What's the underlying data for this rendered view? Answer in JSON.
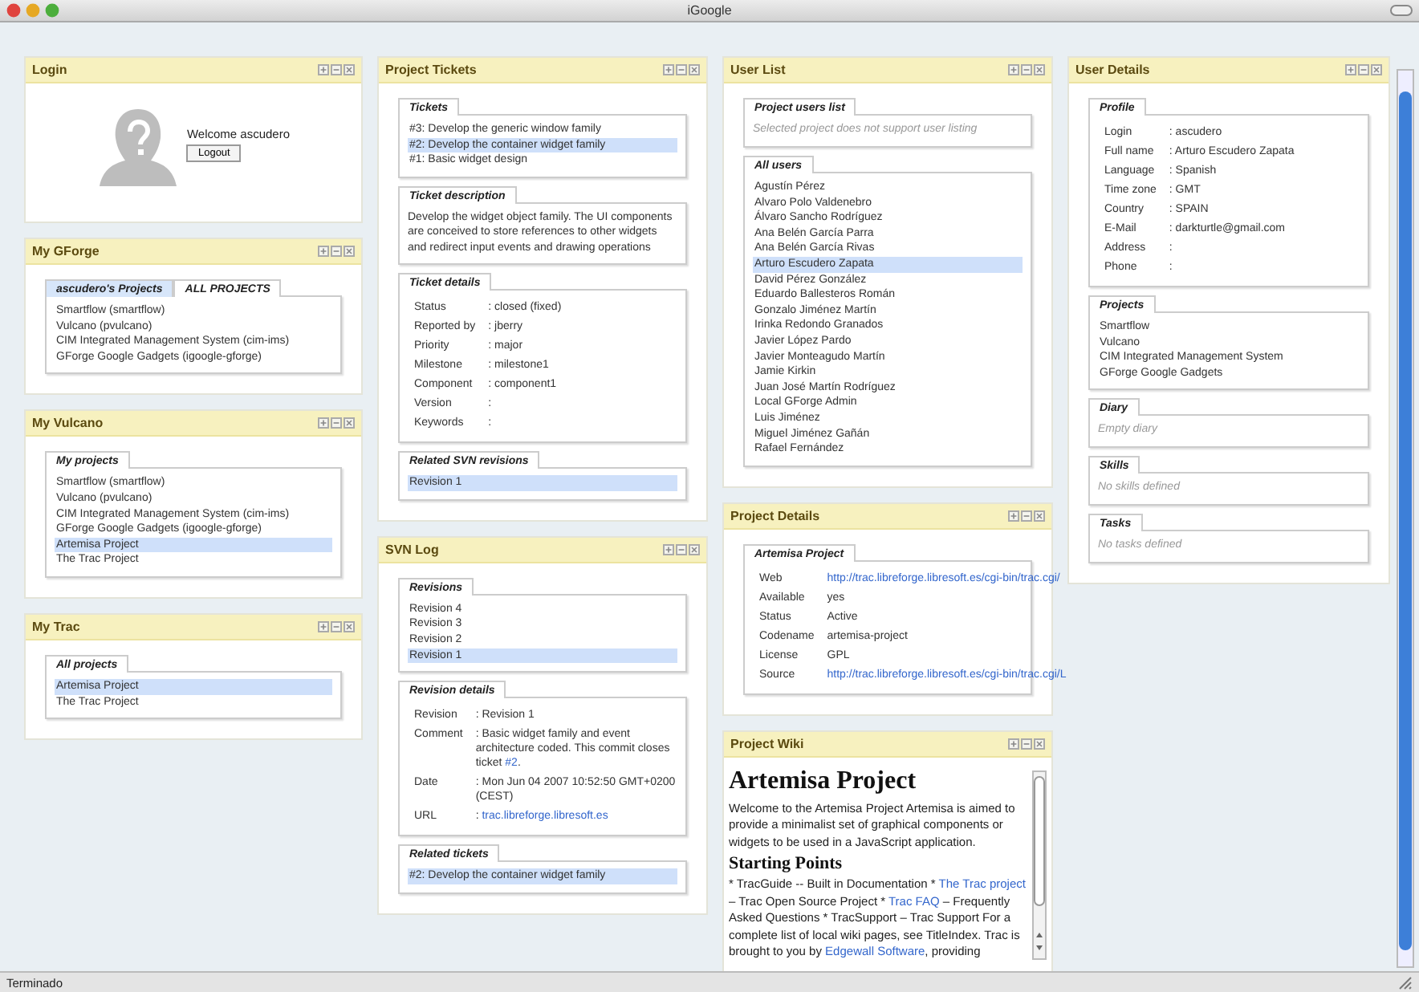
{
  "window": {
    "title": "iGoogle"
  },
  "columns": [
    {
      "gadgets": [
        {
          "title": "Login",
          "sections": [
            {
              "kind": "login",
              "message": "Welcome ascudero",
              "button": "Logout"
            }
          ]
        },
        {
          "title": "My GForge",
          "sections": [
            {
              "kind": "list",
              "tabs": [
                {
                  "label": "ascudero's Projects",
                  "selected": true
                },
                {
                  "label": "ALL PROJECTS",
                  "selected": false
                }
              ],
              "items": [
                {
                  "text": "Smartflow (smartflow)",
                  "selected": false
                },
                {
                  "text": "Vulcano (pvulcano)",
                  "selected": false
                },
                {
                  "text": "CIM Integrated Management System (cim-ims)",
                  "selected": false
                },
                {
                  "text": "GForge Google Gadgets (igoogle-gforge)",
                  "selected": false
                }
              ]
            }
          ]
        },
        {
          "title": "My Vulcano",
          "sections": [
            {
              "kind": "list",
              "label": "My projects",
              "items": [
                {
                  "text": "Smartflow (smartflow)",
                  "selected": false
                },
                {
                  "text": "Vulcano (pvulcano)",
                  "selected": false
                },
                {
                  "text": "CIM Integrated Management System (cim-ims)",
                  "selected": false
                },
                {
                  "text": "GForge Google Gadgets (igoogle-gforge)",
                  "selected": false
                },
                {
                  "text": "Artemisa Project",
                  "selected": true
                },
                {
                  "text": "The Trac Project",
                  "selected": false
                }
              ]
            }
          ]
        },
        {
          "title": "My Trac",
          "sections": [
            {
              "kind": "list",
              "label": "All projects",
              "items": [
                {
                  "text": "Artemisa Project",
                  "selected": true
                },
                {
                  "text": "The Trac Project",
                  "selected": false
                }
              ]
            }
          ]
        }
      ]
    },
    {
      "gadgets": [
        {
          "title": "Project Tickets",
          "sections": [
            {
              "kind": "list",
              "label": "Tickets",
              "items": [
                {
                  "text": "#3: Develop the generic window family",
                  "selected": false
                },
                {
                  "text": "#2: Develop the container widget family",
                  "selected": true
                },
                {
                  "text": "#1: Basic widget design",
                  "selected": false
                }
              ]
            },
            {
              "kind": "text",
              "label": "Ticket description",
              "text": "Develop the widget object family. The UI components are conceived to store references to other widgets and redirect input events and drawing operations"
            },
            {
              "kind": "fields",
              "label": "Ticket details",
              "rows": [
                {
                  "label": "Status",
                  "parts": [
                    {
                      "text": ": closed (fixed)",
                      "link": false
                    }
                  ]
                },
                {
                  "label": "Reported by",
                  "parts": [
                    {
                      "text": ": jberry",
                      "link": false
                    }
                  ]
                },
                {
                  "label": "Priority",
                  "parts": [
                    {
                      "text": ": major",
                      "link": false
                    }
                  ]
                },
                {
                  "label": "Milestone",
                  "parts": [
                    {
                      "text": ": milestone1",
                      "link": false
                    }
                  ]
                },
                {
                  "label": "Component",
                  "parts": [
                    {
                      "text": ": component1",
                      "link": false
                    }
                  ]
                },
                {
                  "label": "Version",
                  "parts": [
                    {
                      "text": ":",
                      "link": false
                    }
                  ]
                },
                {
                  "label": "Keywords",
                  "parts": [
                    {
                      "text": ":",
                      "link": false
                    }
                  ]
                }
              ]
            },
            {
              "kind": "list",
              "label": "Related SVN revisions",
              "items": [
                {
                  "text": "Revision 1",
                  "selected": true
                }
              ]
            }
          ]
        },
        {
          "title": "SVN Log",
          "sections": [
            {
              "kind": "list",
              "label": "Revisions",
              "items": [
                {
                  "text": "Revision 4",
                  "selected": false
                },
                {
                  "text": "Revision 3",
                  "selected": false
                },
                {
                  "text": "Revision 2",
                  "selected": false
                },
                {
                  "text": "Revision 1",
                  "selected": true
                }
              ]
            },
            {
              "kind": "fields",
              "label": "Revision details",
              "rows": [
                {
                  "label": "Revision",
                  "parts": [
                    {
                      "text": ": Revision 1",
                      "link": false
                    }
                  ]
                },
                {
                  "label": "Comment",
                  "parts": [
                    {
                      "text": ": Basic widget family and event architecture coded. This commit closes ticket ",
                      "link": false
                    },
                    {
                      "text": "#2",
                      "link": true
                    },
                    {
                      "text": ".",
                      "link": false
                    }
                  ]
                },
                {
                  "label": "Date",
                  "parts": [
                    {
                      "text": ": Mon Jun 04 2007 10:52:50 GMT+0200 (CEST)",
                      "link": false
                    }
                  ]
                },
                {
                  "label": "URL",
                  "parts": [
                    {
                      "text": ": ",
                      "link": false
                    },
                    {
                      "text": "trac.libreforge.libresoft.es",
                      "link": true
                    }
                  ]
                }
              ]
            },
            {
              "kind": "list",
              "label": "Related tickets",
              "items": [
                {
                  "text": "#2: Develop the container widget family",
                  "selected": true
                }
              ]
            }
          ]
        }
      ]
    },
    {
      "gadgets": [
        {
          "title": "User List",
          "sections": [
            {
              "kind": "note",
              "label": "Project users list",
              "text": "Selected project does not support user listing"
            },
            {
              "kind": "list",
              "label": "All users",
              "items": [
                {
                  "text": "Agustín Pérez",
                  "selected": false
                },
                {
                  "text": "Alvaro Polo Valdenebro",
                  "selected": false
                },
                {
                  "text": "Álvaro Sancho Rodríguez",
                  "selected": false
                },
                {
                  "text": "Ana Belén García Parra",
                  "selected": false
                },
                {
                  "text": "Ana Belén García Rivas",
                  "selected": false
                },
                {
                  "text": "Arturo Escudero Zapata",
                  "selected": true
                },
                {
                  "text": "David Pérez González",
                  "selected": false
                },
                {
                  "text": "Eduardo Ballesteros Román",
                  "selected": false
                },
                {
                  "text": "Gonzalo Jiménez Martín",
                  "selected": false
                },
                {
                  "text": "Irinka Redondo Granados",
                  "selected": false
                },
                {
                  "text": "Javier López Pardo",
                  "selected": false
                },
                {
                  "text": "Javier Monteagudo Martín",
                  "selected": false
                },
                {
                  "text": "Jamie Kirkin",
                  "selected": false
                },
                {
                  "text": "Juan José Martín Rodríguez",
                  "selected": false
                },
                {
                  "text": "Local GForge Admin",
                  "selected": false
                },
                {
                  "text": "Luis Jiménez",
                  "selected": false
                },
                {
                  "text": "Miguel Jiménez Gañán",
                  "selected": false
                },
                {
                  "text": "Rafael Fernández",
                  "selected": false
                }
              ]
            }
          ]
        },
        {
          "title": "Project Details",
          "sections": [
            {
              "kind": "fields",
              "label": "Artemisa Project",
              "rows": [
                {
                  "label": "Web",
                  "parts": [
                    {
                      "text": "http://trac.libreforge.libresoft.es/cgi-bin/trac.cgi/",
                      "link": true
                    }
                  ]
                },
                {
                  "label": "Available",
                  "parts": [
                    {
                      "text": "yes",
                      "link": false
                    }
                  ]
                },
                {
                  "label": "Status",
                  "parts": [
                    {
                      "text": "Active",
                      "link": false
                    }
                  ]
                },
                {
                  "label": "Codename",
                  "parts": [
                    {
                      "text": "artemisa-project",
                      "link": false
                    }
                  ]
                },
                {
                  "label": "License",
                  "parts": [
                    {
                      "text": "GPL",
                      "link": false
                    }
                  ]
                },
                {
                  "label": "Source",
                  "parts": [
                    {
                      "text": "http://trac.libreforge.libresoft.es/cgi-bin/trac.cgi/L",
                      "link": true
                    }
                  ]
                }
              ]
            }
          ]
        },
        {
          "title": "Project Wiki",
          "sections": [
            {
              "kind": "wiki",
              "heading": "Artemisa Project",
              "intro": "Welcome to the Artemisa Project Artemisa is aimed to provide a minimalist set of graphical components or widgets to be used in a JavaScript application.",
              "subheading": "Starting Points",
              "parts": [
                {
                  "text": "* TracGuide -- Built in Documentation * ",
                  "link": false
                },
                {
                  "text": "The Trac project",
                  "link": true
                },
                {
                  "text": " – Trac Open Source Project * ",
                  "link": false
                },
                {
                  "text": "Trac FAQ",
                  "link": true
                },
                {
                  "text": " – Frequently Asked Questions * TracSupport – Trac Support For a complete list of local wiki pages, see TitleIndex. Trac is brought to you by ",
                  "link": false
                },
                {
                  "text": "Edgewall Software",
                  "link": true
                },
                {
                  "text": ", providing",
                  "link": false
                }
              ]
            }
          ]
        }
      ]
    },
    {
      "gadgets": [
        {
          "title": "User Details",
          "sections": [
            {
              "kind": "fields",
              "label": "Profile",
              "rows": [
                {
                  "label": "Login",
                  "parts": [
                    {
                      "text": ": ascudero",
                      "link": false
                    }
                  ]
                },
                {
                  "label": "Full name",
                  "parts": [
                    {
                      "text": ": Arturo Escudero Zapata",
                      "link": false
                    }
                  ]
                },
                {
                  "label": "Language",
                  "parts": [
                    {
                      "text": ": Spanish",
                      "link": false
                    }
                  ]
                },
                {
                  "label": "Time zone",
                  "parts": [
                    {
                      "text": ": GMT",
                      "link": false
                    }
                  ]
                },
                {
                  "label": "Country",
                  "parts": [
                    {
                      "text": ": SPAIN",
                      "link": false
                    }
                  ]
                },
                {
                  "label": "E-Mail",
                  "parts": [
                    {
                      "text": ": darkturtle@gmail.com",
                      "link": false
                    }
                  ]
                },
                {
                  "label": "Address",
                  "parts": [
                    {
                      "text": ":",
                      "link": false
                    }
                  ]
                },
                {
                  "label": "Phone",
                  "parts": [
                    {
                      "text": ":",
                      "link": false
                    }
                  ]
                }
              ]
            },
            {
              "kind": "list",
              "label": "Projects",
              "items": [
                {
                  "text": "Smartflow",
                  "selected": false
                },
                {
                  "text": "Vulcano",
                  "selected": false
                },
                {
                  "text": "CIM Integrated Management System",
                  "selected": false
                },
                {
                  "text": "GForge Google Gadgets",
                  "selected": false
                }
              ]
            },
            {
              "kind": "note",
              "label": "Diary",
              "text": "Empty diary"
            },
            {
              "kind": "note",
              "label": "Skills",
              "text": "No skills defined"
            },
            {
              "kind": "note",
              "label": "Tasks",
              "text": "No tasks defined"
            }
          ]
        }
      ]
    }
  ],
  "status_bar": "Terminado"
}
